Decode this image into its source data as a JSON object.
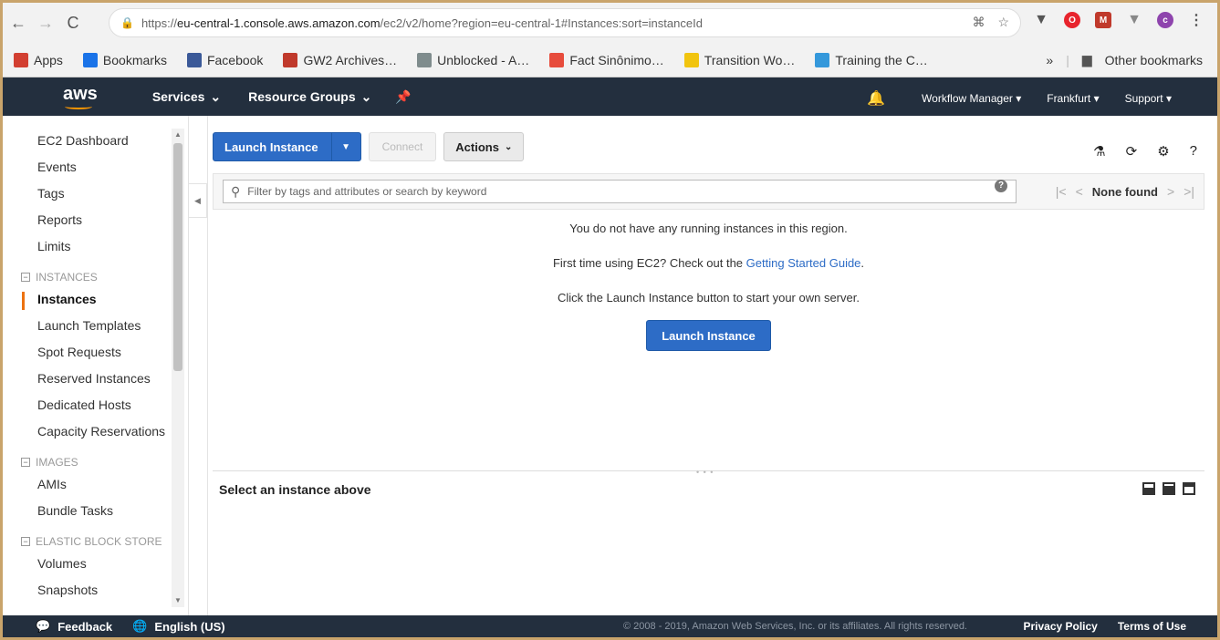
{
  "browser": {
    "url_scheme": "https://",
    "url_host": "eu-central-1.console.aws.amazon.com",
    "url_path": "/ec2/v2/home?region=eu-central-1#Instances:sort=instanceId",
    "bookmarks": [
      {
        "label": "Apps",
        "icon": "apps-icon",
        "color": "#d23f31"
      },
      {
        "label": "Bookmarks",
        "icon": "star-icon",
        "color": "#1a73e8"
      },
      {
        "label": "Facebook",
        "icon": "facebook-icon",
        "color": "#3b5998"
      },
      {
        "label": "GW2 Archives…",
        "icon": "gw2-icon",
        "color": "#c0392b"
      },
      {
        "label": "Unblocked - A…",
        "icon": "unblocked-icon",
        "color": "#7f8c8d"
      },
      {
        "label": "Fact Sinônimo…",
        "icon": "fact-icon",
        "color": "#e74c3c"
      },
      {
        "label": "Transition Wo…",
        "icon": "transition-icon",
        "color": "#f1c40f"
      },
      {
        "label": "Training the C…",
        "icon": "training-icon",
        "color": "#3498db"
      }
    ],
    "more_label": "»",
    "other_bookmarks": "Other bookmarks"
  },
  "header": {
    "logo": "aws",
    "services": "Services",
    "resource_groups": "Resource Groups",
    "account": "Workflow Manager",
    "region": "Frankfurt",
    "support": "Support"
  },
  "sidebar": {
    "items_top": [
      "EC2 Dashboard",
      "Events",
      "Tags",
      "Reports",
      "Limits"
    ],
    "instances_section": "INSTANCES",
    "instances_items": [
      "Instances",
      "Launch Templates",
      "Spot Requests",
      "Reserved Instances",
      "Dedicated Hosts",
      "Capacity Reservations"
    ],
    "images_section": "IMAGES",
    "images_items": [
      "AMIs",
      "Bundle Tasks"
    ],
    "ebs_section": "ELASTIC BLOCK STORE",
    "ebs_items": [
      "Volumes",
      "Snapshots"
    ]
  },
  "toolbar": {
    "launch": "Launch Instance",
    "connect": "Connect",
    "actions": "Actions"
  },
  "filter": {
    "placeholder": "Filter by tags and attributes or search by keyword",
    "pager_status": "None found"
  },
  "empty_state": {
    "line1": "You do not have any running instances in this region.",
    "line2_pre": "First time using EC2? Check out the",
    "line2_link": "Getting Started Guide",
    "line2_post": ".",
    "line3": "Click the Launch Instance button to start your own server.",
    "button": "Launch Instance"
  },
  "details": {
    "title": "Select an instance above"
  },
  "footer": {
    "feedback": "Feedback",
    "language": "English (US)",
    "copyright": "© 2008 - 2019, Amazon Web Services, Inc. or its affiliates. All rights reserved.",
    "privacy": "Privacy Policy",
    "terms": "Terms of Use"
  }
}
